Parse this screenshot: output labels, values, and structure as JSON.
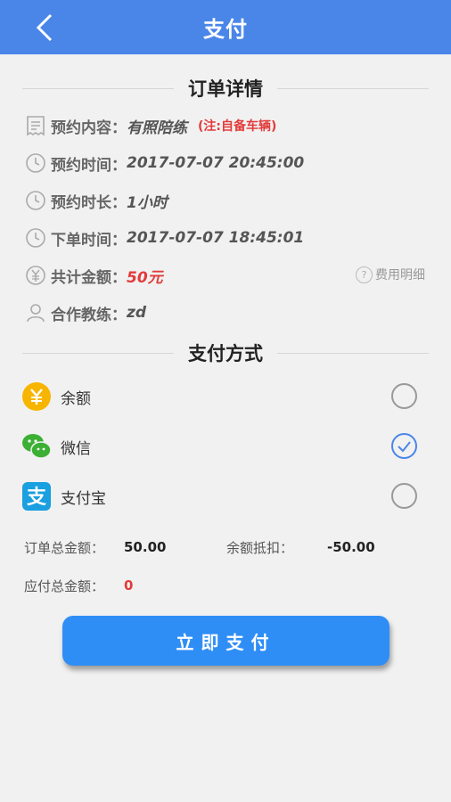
{
  "header": {
    "title": "支付",
    "back_icon": "chevron-left-icon"
  },
  "order": {
    "section_title": "订单详情",
    "content": {
      "label": "预约内容：",
      "value": "有照陪练",
      "note": "(注:自备车辆)"
    },
    "time": {
      "label": "预约时间：",
      "value": "2017-07-07 20:45:00"
    },
    "duration": {
      "label": "预约时长：",
      "value": "1小时"
    },
    "placed": {
      "label": "下单时间：",
      "value": "2017-07-07 18:45:01"
    },
    "total": {
      "label": "共计金额：",
      "value": "50元",
      "fee_link": "费用明细"
    },
    "coach": {
      "label": "合作教练：",
      "value": "zd"
    }
  },
  "payment": {
    "section_title": "支付方式",
    "methods": [
      {
        "label": "余额",
        "icon": "yuan-balance-icon",
        "checked": false
      },
      {
        "label": "微信",
        "icon": "wechat-icon",
        "checked": true
      },
      {
        "label": "支付宝",
        "icon": "alipay-icon",
        "checked": false
      }
    ]
  },
  "summary": {
    "order_total_label": "订单总金额：",
    "order_total_value": "50.00",
    "balance_deduct_label": "余额抵扣：",
    "balance_deduct_value": "-50.00",
    "payable_label": "应付总金额：",
    "payable_value": "0"
  },
  "actions": {
    "pay_now": "立即支付"
  },
  "colors": {
    "header": "#4a86e8",
    "button": "#2f8ef5",
    "accent_red": "#e23b3b"
  }
}
